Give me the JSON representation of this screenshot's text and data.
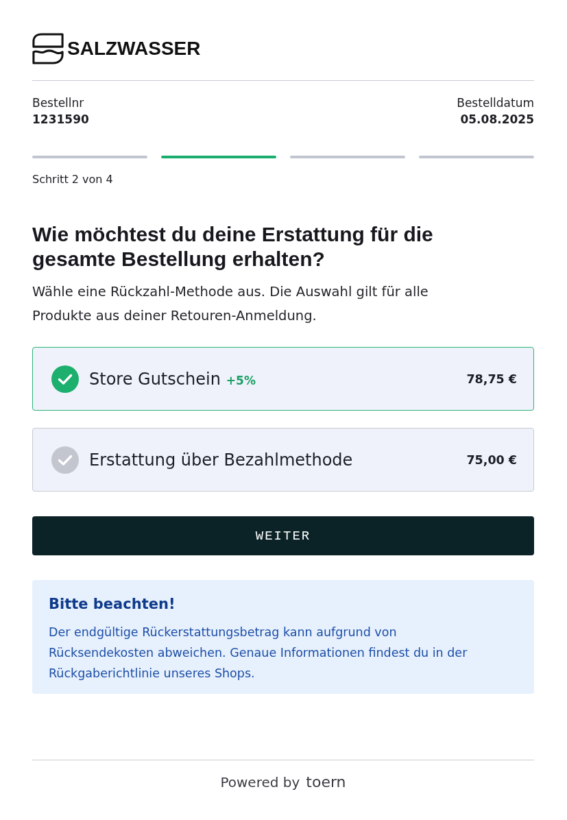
{
  "logo": {
    "text": "SALZWASSER"
  },
  "order": {
    "number_label": "Bestellnr",
    "number": "1231590",
    "date_label": "Bestelldatum",
    "date": "05.08.2025"
  },
  "progress": {
    "steps": [
      {
        "active": false
      },
      {
        "active": true
      },
      {
        "active": false
      },
      {
        "active": false
      }
    ],
    "caption": "Schritt 2 von 4"
  },
  "question": {
    "title": "Wie möchtest du deine Erstattung für die gesamte Bestellung erhalten?",
    "subtitle": "Wähle eine Rückzahl-Methode aus. Die Auswahl gilt für alle Produkte aus deiner Retouren-Anmeldung."
  },
  "options": [
    {
      "label": "Store Gutschein",
      "bonus": "+5%",
      "amount": "78,75 €",
      "selected": true
    },
    {
      "label": "Erstattung über Bezahlmethode",
      "amount": "75,00 €",
      "selected": false
    }
  ],
  "button": {
    "label": "WEITER"
  },
  "notice": {
    "title": "Bitte beachten!",
    "text": "Der endgültige Rückerstattungsbetrag kann aufgrund von Rücksendekosten abweichen. Genaue Informationen findest du in der Rückgaberichtlinie unseres Shops."
  },
  "footer": {
    "prefix": "Powered by",
    "brand": "toern"
  }
}
